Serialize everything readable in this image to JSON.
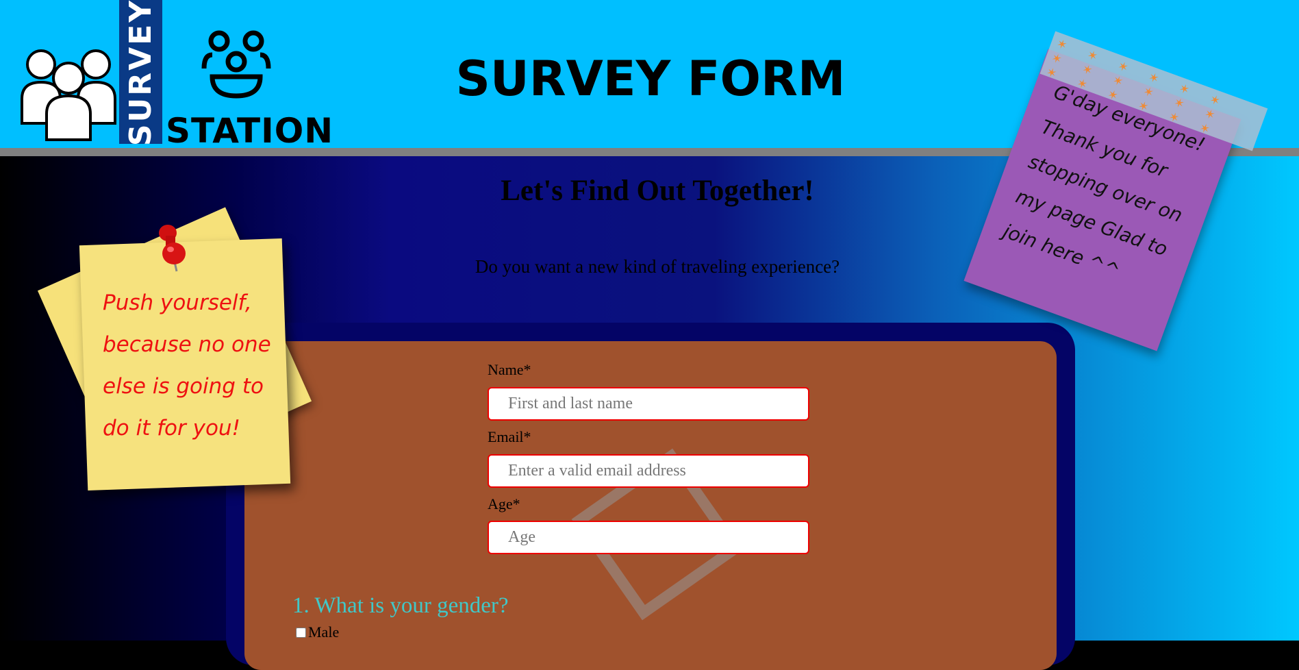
{
  "header": {
    "logo_survey": "SURVEY",
    "logo_station": "STATION",
    "title": "SURVEY FORM",
    "logo_people_icon": "people-group-icon",
    "logo_group_icon": "users-circle-icon"
  },
  "main": {
    "heading": "Let's Find Out Together!",
    "subheading": "Do you want a new kind of traveling experience?"
  },
  "form": {
    "name_label": "Name*",
    "name_placeholder": "First and last name",
    "email_label": "Email*",
    "email_placeholder": "Enter a valid email address",
    "age_label": "Age*",
    "age_placeholder": "Age",
    "question1": "1. What is your gender?",
    "option_male": "Male"
  },
  "notes": {
    "left_text": "Push yourself, because no one else is going to do it for you!",
    "right_text": "G'day everyone! Thank you for stopping over on my page Glad to join here ^^"
  },
  "colors": {
    "header_bg": "#00bfff",
    "form_bg": "#a0522d",
    "form_border": "#040466",
    "question_color": "#40c8c8",
    "left_note_text": "#ee1111",
    "right_note_bg": "#9b59b6"
  }
}
